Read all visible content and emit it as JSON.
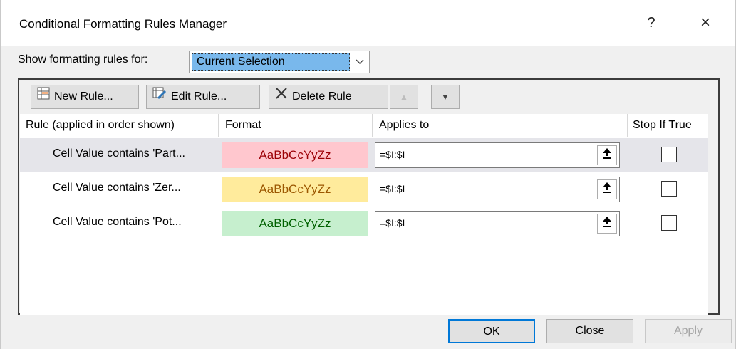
{
  "window": {
    "title": "Conditional Formatting Rules Manager",
    "help_label": "?",
    "close_label": "×"
  },
  "show_for": {
    "label": "Show formatting rules for:",
    "value": "Current Selection"
  },
  "toolbar": {
    "new_rule": "New Rule...",
    "edit_rule": "Edit Rule...",
    "delete_rule": "Delete Rule",
    "move_up": "▲",
    "move_down": "▼"
  },
  "table": {
    "headers": {
      "rule": "Rule (applied in order shown)",
      "format": "Format",
      "applies_to": "Applies to",
      "stop_if_true": "Stop If True"
    },
    "rows": [
      {
        "rule": "Cell Value contains 'Part...",
        "format_preview": "AaBbCcYyZz",
        "format_bg": "#ffc7ce",
        "format_color": "#9c0006",
        "applies_to": "=$I:$I",
        "stop_if_true": false,
        "selected": true
      },
      {
        "rule": "Cell Value contains 'Zer...",
        "format_preview": "AaBbCcYyZz",
        "format_bg": "#ffeb9c",
        "format_color": "#9c5700",
        "applies_to": "=$I:$I",
        "stop_if_true": false,
        "selected": false
      },
      {
        "rule": "Cell Value contains 'Pot...",
        "format_preview": "AaBbCcYyZz",
        "format_bg": "#c6efce",
        "format_color": "#006100",
        "applies_to": "=$I:$I",
        "stop_if_true": false,
        "selected": false
      }
    ]
  },
  "footer": {
    "ok": "OK",
    "close": "Close",
    "apply": "Apply"
  },
  "colors": {
    "accent": "#0078d7",
    "selection": "#79b8ec"
  }
}
